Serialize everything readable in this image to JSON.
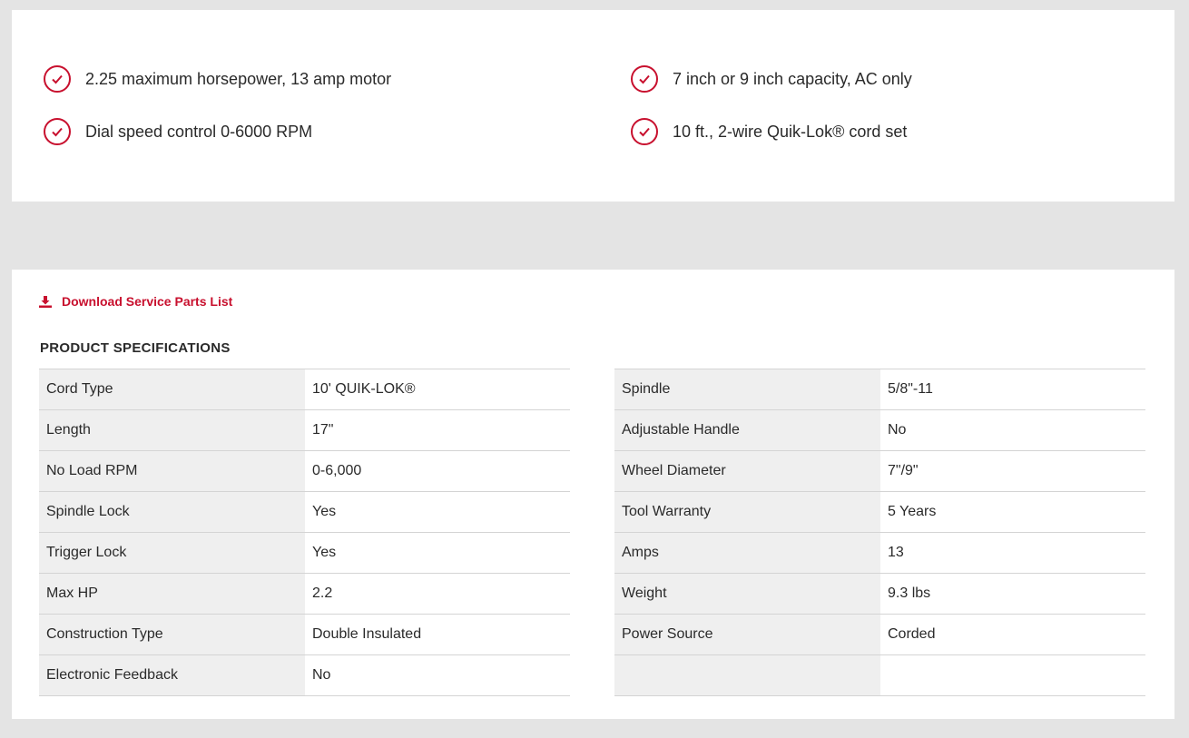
{
  "features": [
    {
      "text": "2.25 maximum horsepower, 13 amp motor"
    },
    {
      "text": "7 inch or 9 inch capacity, AC only"
    },
    {
      "text": "Dial speed control 0-6000 RPM"
    },
    {
      "text": "10 ft., 2-wire Quik-Lok® cord set"
    }
  ],
  "download": {
    "label": "Download Service Parts List",
    "icon": "download-icon"
  },
  "specs": {
    "title": "PRODUCT SPECIFICATIONS",
    "left": [
      {
        "key": "Cord Type",
        "value": "10' QUIK-LOK®"
      },
      {
        "key": "Length",
        "value": "17\""
      },
      {
        "key": "No Load RPM",
        "value": "0-6,000"
      },
      {
        "key": "Spindle Lock",
        "value": "Yes"
      },
      {
        "key": "Trigger Lock",
        "value": "Yes"
      },
      {
        "key": "Max HP",
        "value": "2.2"
      },
      {
        "key": "Construction Type",
        "value": "Double Insulated"
      },
      {
        "key": "Electronic Feedback",
        "value": "No"
      }
    ],
    "right": [
      {
        "key": "Spindle",
        "value": "5/8\"-11"
      },
      {
        "key": "Adjustable Handle",
        "value": "No"
      },
      {
        "key": "Wheel Diameter",
        "value": "7\"/9\""
      },
      {
        "key": "Tool Warranty",
        "value": "5 Years"
      },
      {
        "key": "Amps",
        "value": "13"
      },
      {
        "key": "Weight",
        "value": "9.3 lbs"
      },
      {
        "key": "Power Source",
        "value": "Corded"
      },
      {
        "key": "",
        "value": ""
      }
    ]
  },
  "colors": {
    "accent": "#c8102e",
    "background": "#e4e4e4",
    "panel": "#ffffff",
    "key_cell": "#efefef"
  }
}
